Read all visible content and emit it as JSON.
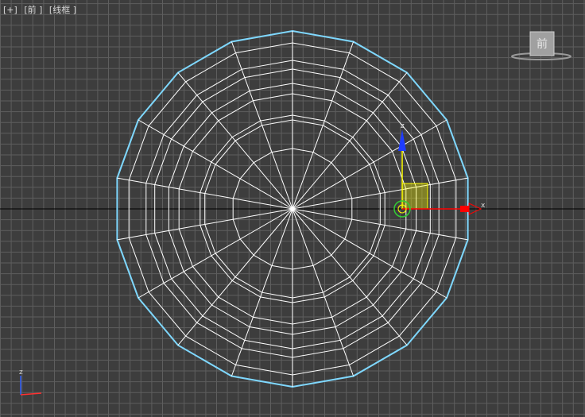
{
  "viewport": {
    "menu_plus": "[+]",
    "view_name": "[前 ]",
    "shading_mode": "[线框 ]"
  },
  "viewcube": {
    "face_label": "前"
  },
  "gizmo": {
    "x_label": "x",
    "z_label": "z"
  },
  "axis_tripod": {
    "z_label": "z"
  },
  "colors": {
    "background": "#3d3d3d",
    "grid": "#5e5e5e",
    "selection_outline": "#7fd8ff",
    "wireframe": "#ffffff",
    "gizmo_x": "#ff0000",
    "gizmo_z": "#0000ff",
    "gizmo_plane": "#ffff00"
  },
  "icons": [
    "viewcube-icon",
    "move-gizmo-icon",
    "axis-tripod-icon"
  ]
}
